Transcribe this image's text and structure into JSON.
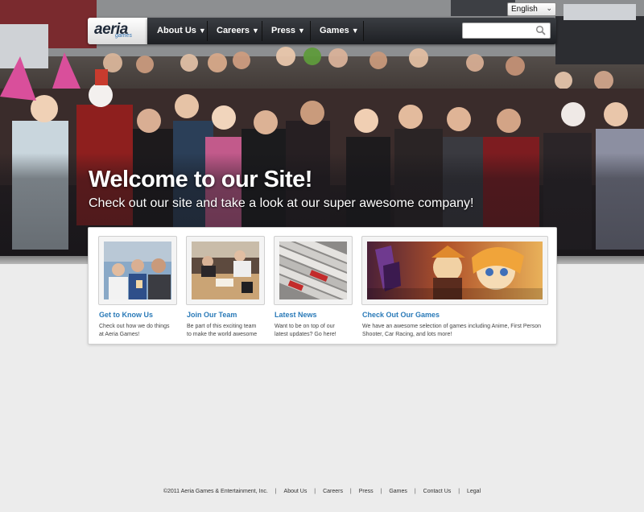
{
  "language": {
    "selected": "English"
  },
  "logo": {
    "text": "aeria",
    "sub": "games"
  },
  "nav": {
    "items": [
      {
        "label": "About Us"
      },
      {
        "label": "Careers"
      },
      {
        "label": "Press"
      },
      {
        "label": "Games"
      }
    ],
    "search_value": ""
  },
  "hero": {
    "title": "Welcome to our Site!",
    "subtitle": "Check out our site and take a look at our super awesome company!"
  },
  "cards": [
    {
      "title": "Get to Know Us",
      "description_lines": [
        "Check out how we do things",
        "at Aeria Games!"
      ]
    },
    {
      "title": "Join Our Team",
      "description_lines": [
        "Be part of this exciting team",
        "to make the world awesome"
      ]
    },
    {
      "title": "Latest News",
      "description_lines": [
        "Want to be on top of our",
        "latest updates? Go here!"
      ]
    },
    {
      "title": "Check Out Our Games",
      "description_lines": [
        "We have an awesome selection of games including Anime, First Person",
        "Shooter, Car Racing, and lots more!"
      ]
    }
  ],
  "footer": {
    "copyright": "©2011 Aeria Games & Entertainment, Inc.",
    "links": [
      "About Us",
      "Careers",
      "Press",
      "Games",
      "Contact Us",
      "Legal"
    ]
  },
  "colors": {
    "link_blue": "#2a7ab8",
    "nav_dark": "#1d1f23",
    "page_bg": "#ececec"
  }
}
